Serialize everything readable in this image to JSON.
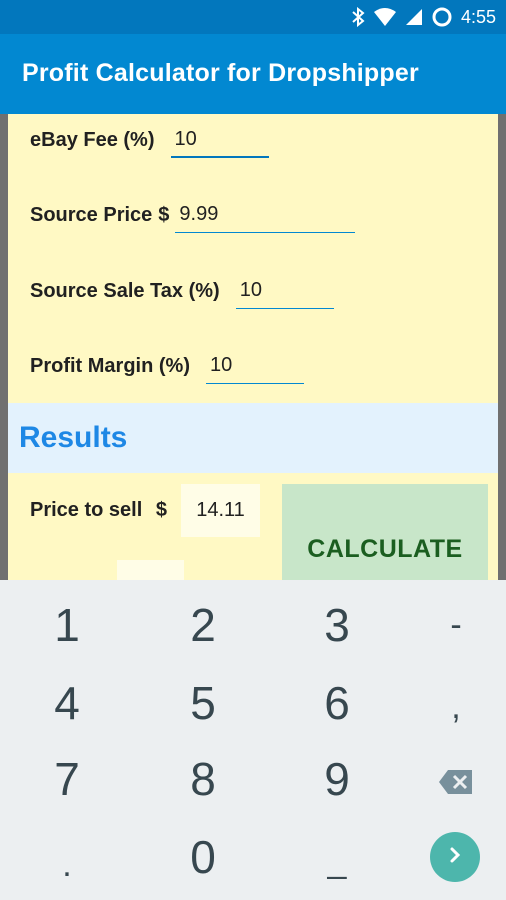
{
  "status": {
    "time": "4:55"
  },
  "app": {
    "title": "Profit Calculator for Dropshipper"
  },
  "fields": {
    "ebay_fee": {
      "label": "eBay Fee (%)",
      "value": "10"
    },
    "source_price": {
      "label": "Source Price",
      "currency": "$",
      "value": "9.99"
    },
    "source_tax": {
      "label": "Source Sale Tax (%)",
      "value": "10"
    },
    "profit_margin": {
      "label": "Profit Margin (%)",
      "value": "10"
    }
  },
  "results": {
    "title": "Results",
    "price_label": "Price to sell",
    "price_currency": "$",
    "price_value": "14.11",
    "calculate_label": "CALCULATE"
  },
  "keyboard": {
    "keys": [
      "1",
      "2",
      "3",
      "-",
      "4",
      "5",
      "6",
      ",",
      "7",
      "8",
      "9",
      ".",
      "0",
      "_"
    ]
  },
  "colors": {
    "status_bar": "#0277BD",
    "app_bar": "#0288D1",
    "content_bg": "#FFF9C4",
    "results_bg": "#E3F2FD",
    "results_title": "#1E88E5",
    "calculate_bg": "#C8E6C9",
    "calculate_text": "#1B5E20",
    "keyboard_bg": "#ECEFF1",
    "go_button": "#4DB6AC"
  }
}
